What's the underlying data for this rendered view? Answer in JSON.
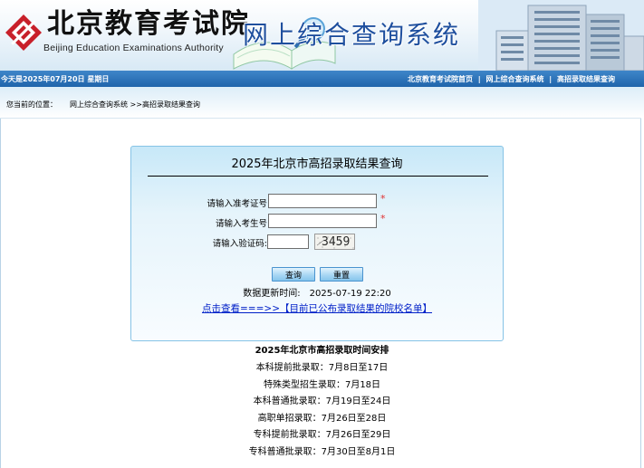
{
  "header": {
    "logo_cn": "北京教育考试院",
    "logo_en": "Beijing Education Examinations Authority",
    "site_title": "网上综合查询系统"
  },
  "navbar": {
    "today": "今天是2025年07月20日  星期日",
    "links": [
      "北京教育考试院首页",
      "网上综合查询系统",
      "高招录取结果查询"
    ],
    "separator": "|"
  },
  "breadcrumb": {
    "label": "您当前的位置：",
    "path": "网上综合查询系统 >>高招录取结果查询"
  },
  "query_form": {
    "title": "2025年北京市高招录取结果查询",
    "exam_id_label": "请输入准考证号",
    "exam_id_value": "",
    "student_id_label": "请输入考生号",
    "student_id_value": "",
    "captcha_label": "请输入验证码:",
    "captcha_value": "",
    "captcha_image_text": "3459",
    "required_mark": "*",
    "submit_label": "查询",
    "reset_label": "重置",
    "update_label": "数据更新时间:",
    "update_time": "2025-07-19 22:20",
    "list_link": "点击查看===>>【目前已公布录取结果的院校名单】"
  },
  "schedule": {
    "title": "2025年北京市高招录取时间安排",
    "items": [
      "本科提前批录取：7月8日至17日",
      "特殊类型招生录取：7月18日",
      "本科普通批录取：7月19日至24日",
      "高职单招录取：7月26日至28日",
      "专科提前批录取：7月26日至29日",
      "专科普通批录取：7月30日至8月1日"
    ]
  },
  "colors": {
    "nav_bar": "#2a72b8",
    "title_blue": "#1e4f9e",
    "logo_red": "#c8202a",
    "required": "#e03030",
    "link": "#0020c8"
  }
}
